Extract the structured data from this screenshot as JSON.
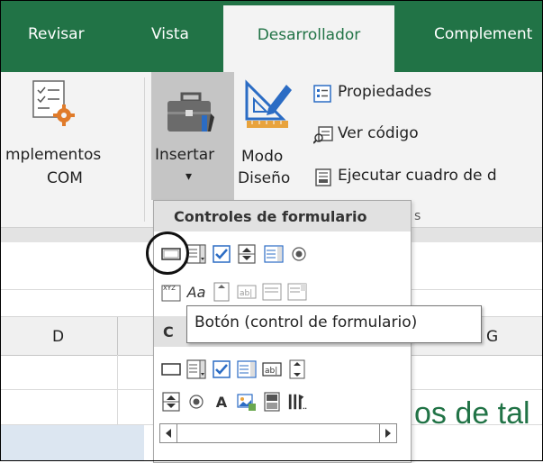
{
  "ribbon_tabs": {
    "revisar": "Revisar",
    "vista": "Vista",
    "desarrollador": "Desarrollador",
    "complementos": "Complement"
  },
  "ribbon": {
    "complementos_com_line1": "mplementos",
    "complementos_com_line2": "COM",
    "insertar_label": "Insertar",
    "insertar_arrow": "▾",
    "modo_line1": "Modo",
    "modo_line2": "Diseño",
    "propiedades": "Propiedades",
    "ver_codigo": "Ver código",
    "ejecutar_cuadro": "Ejecutar cuadro de d",
    "group_label_partial": "s"
  },
  "sheet": {
    "column_d": "D",
    "column_c_partial": "C",
    "column_g": "G",
    "cell_text_partial": "os de tal"
  },
  "dropdown": {
    "form_controls_header": "Controles de formulario",
    "activex_header_partial": "C",
    "form_controls_row2_label": "Aa"
  },
  "tooltip": {
    "text": "Botón (control de formulario)"
  },
  "colors": {
    "ribbon_green": "#217346",
    "ribbon_bg": "#f3f3f3",
    "dropdown_header_bg": "#e1e1e1",
    "checkbox_blue": "#2b6cc4"
  }
}
